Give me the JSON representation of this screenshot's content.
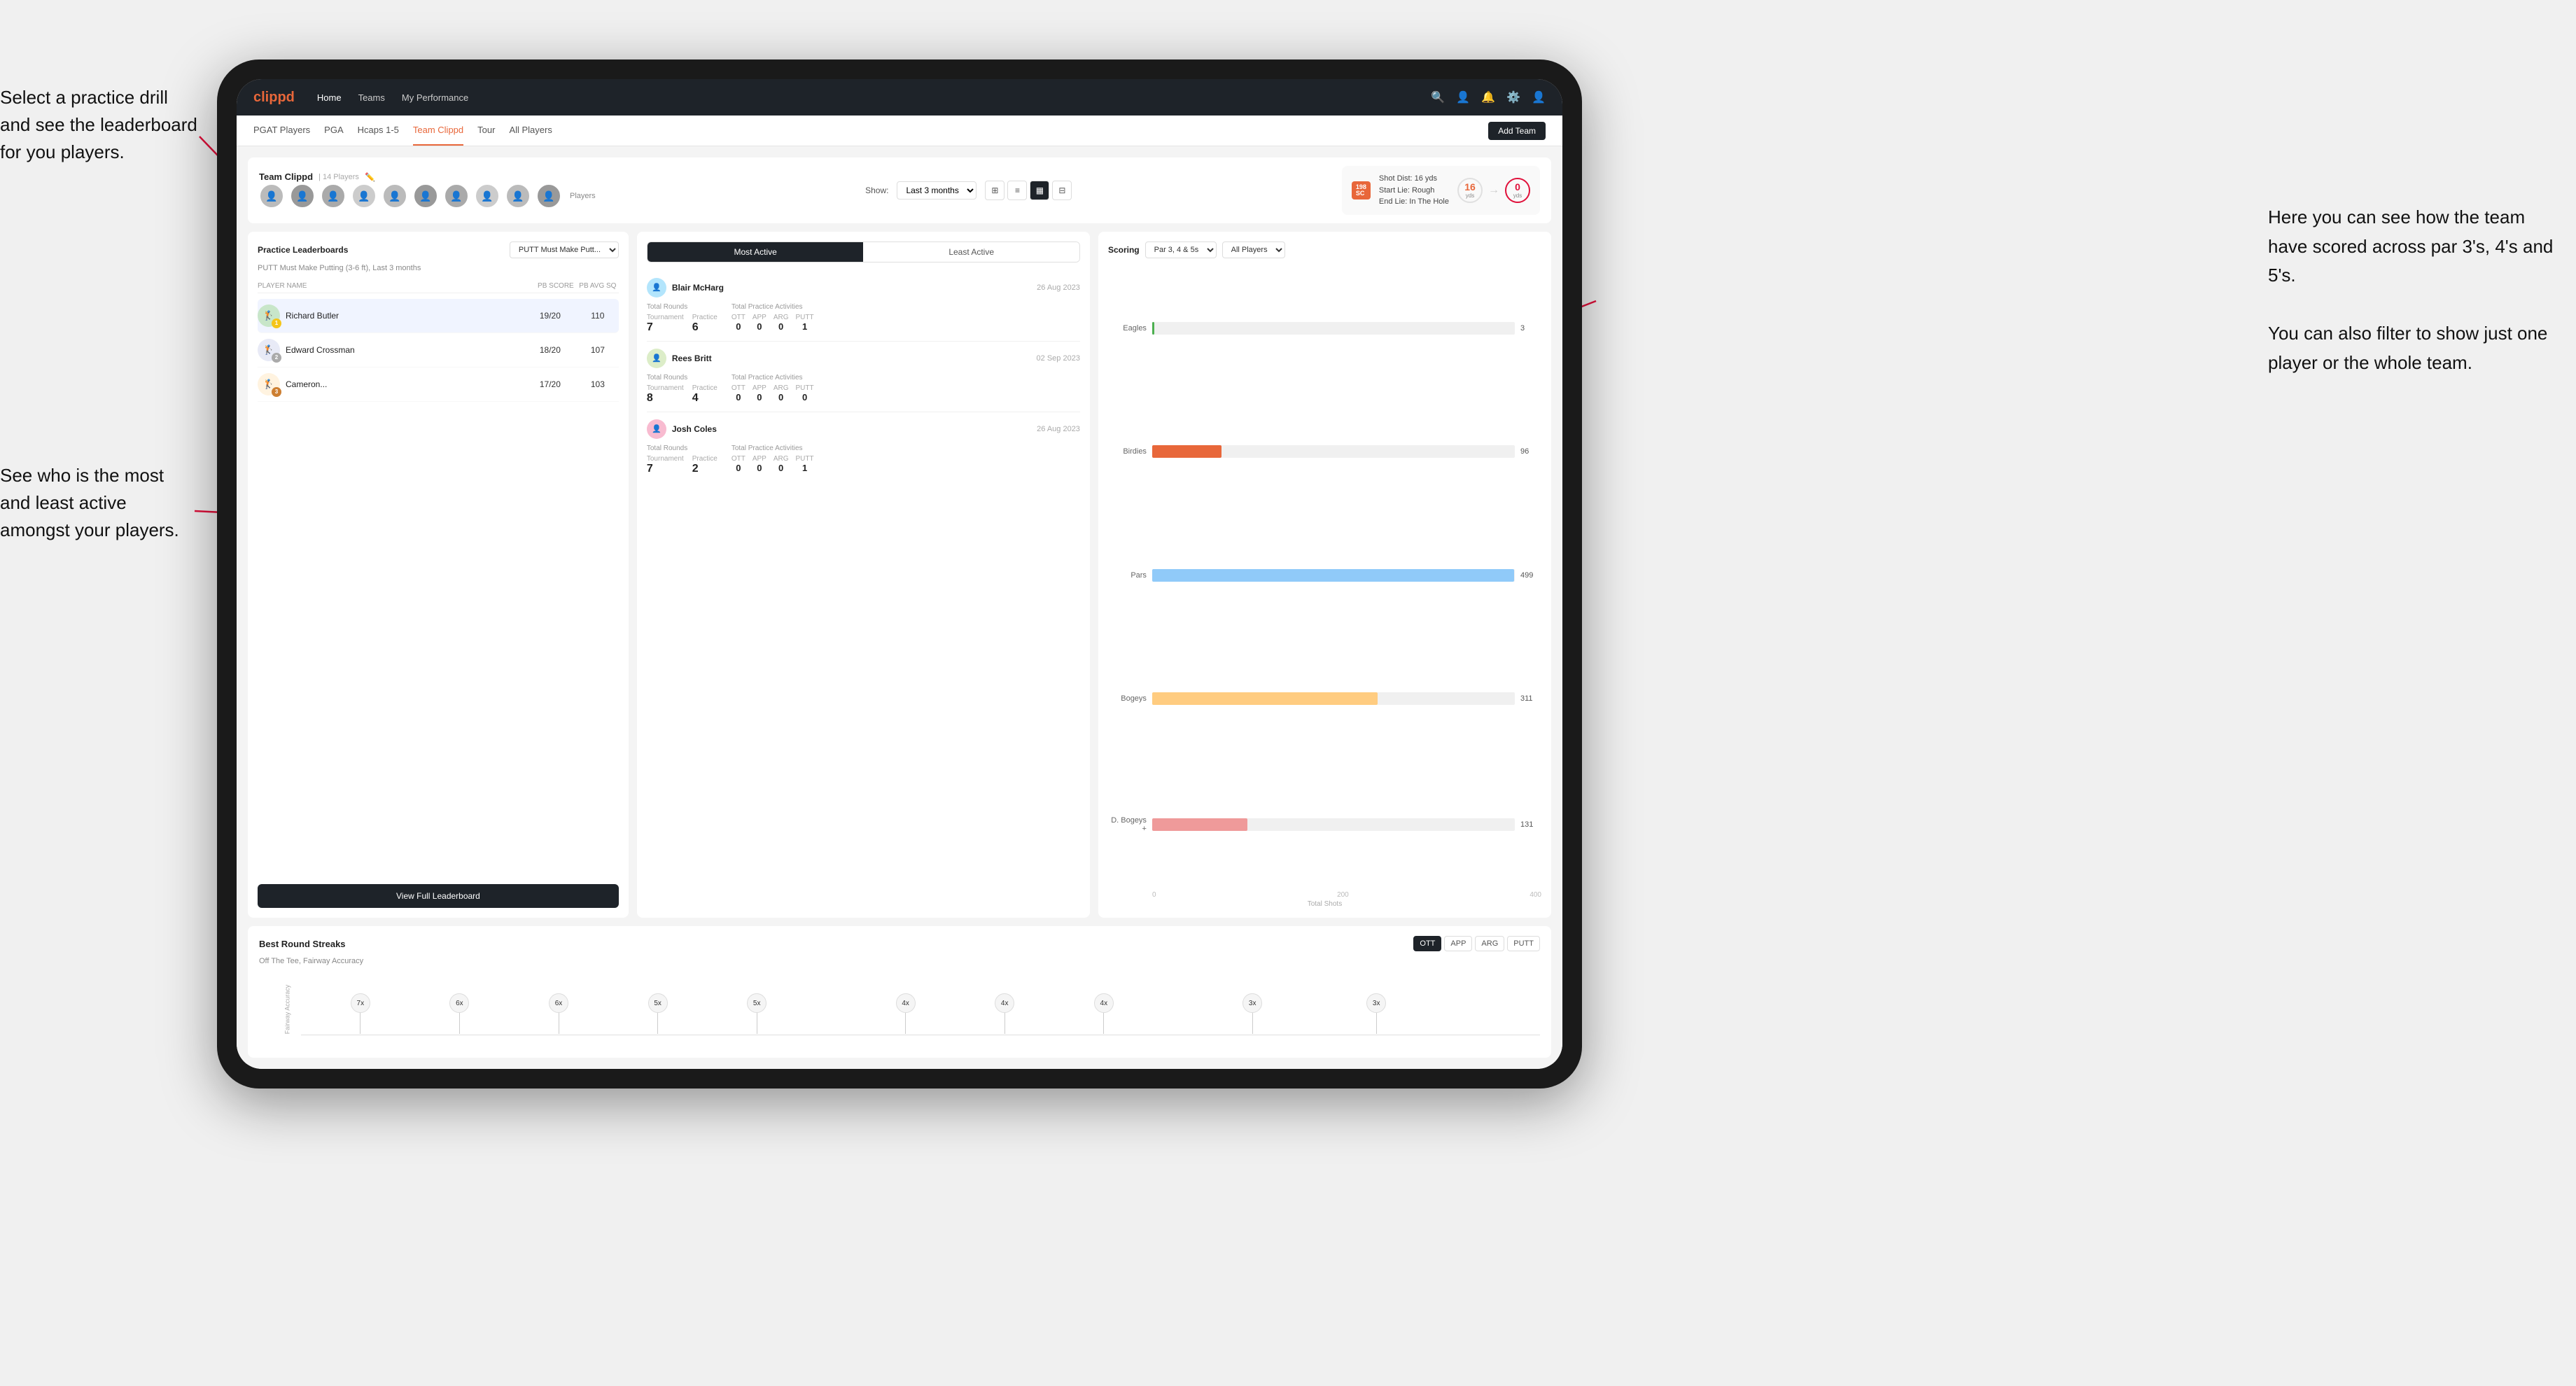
{
  "annotations": {
    "top_left": "Select a practice drill and see\nthe leaderboard for you players.",
    "bottom_left": "See who is the most and least\nactive amongst your players.",
    "top_right": "Here you can see how the\nteam have scored across\npar 3's, 4's and 5's.\n\nYou can also filter to show\njust one player or the whole\nteam."
  },
  "nav": {
    "logo": "clippd",
    "items": [
      "Home",
      "Teams",
      "My Performance"
    ],
    "icons": [
      "🔍",
      "👤",
      "🔔",
      "⚙️",
      "👤"
    ]
  },
  "subnav": {
    "items": [
      "PGAT Players",
      "PGA",
      "Hcaps 1-5",
      "Team Clippd",
      "Tour",
      "All Players"
    ],
    "active": "Team Clippd",
    "add_team": "Add Team"
  },
  "team_header": {
    "title": "Team Clippd",
    "player_count": "14 Players",
    "show_label": "Show:",
    "show_value": "Last 3 months",
    "avatars": [
      "👤",
      "👤",
      "👤",
      "👤",
      "👤",
      "👤",
      "👤",
      "👤",
      "👤",
      "👤"
    ],
    "players_label": "Players",
    "shot": {
      "badge": "198",
      "badge_sub": "SC",
      "dist_label": "Shot Dist: 16 yds",
      "start_lie": "Start Lie: Rough",
      "end_lie": "End Lie: In The Hole",
      "circle1_val": "16",
      "circle1_unit": "yds",
      "circle2_val": "0",
      "circle2_unit": "yds"
    }
  },
  "leaderboard": {
    "title": "Practice Leaderboards",
    "drill": "PUTT Must Make Putt...",
    "subtitle": "PUTT Must Make Putting (3-6 ft), Last 3 months",
    "col_name": "PLAYER NAME",
    "col_score": "PB SCORE",
    "col_avg": "PB AVG SQ",
    "players": [
      {
        "name": "Richard Butler",
        "score": "19/20",
        "avg": "110",
        "rank": 1,
        "badge": "gold",
        "badge_num": "1"
      },
      {
        "name": "Edward Crossman",
        "score": "18/20",
        "avg": "107",
        "rank": 2,
        "badge": "silver",
        "badge_num": "2"
      },
      {
        "name": "Cameron...",
        "score": "17/20",
        "avg": "103",
        "rank": 3,
        "badge": "bronze",
        "badge_num": "3"
      }
    ],
    "view_full": "View Full Leaderboard"
  },
  "activity": {
    "tab_active": "Most Active",
    "tab_inactive": "Least Active",
    "players": [
      {
        "name": "Blair McHarg",
        "date": "26 Aug 2023",
        "rounds_label": "Total Rounds",
        "tournament": "7",
        "practice": "6",
        "activities_label": "Total Practice Activities",
        "ott": "0",
        "app": "0",
        "arg": "0",
        "putt": "1"
      },
      {
        "name": "Rees Britt",
        "date": "02 Sep 2023",
        "rounds_label": "Total Rounds",
        "tournament": "8",
        "practice": "4",
        "activities_label": "Total Practice Activities",
        "ott": "0",
        "app": "0",
        "arg": "0",
        "putt": "0"
      },
      {
        "name": "Josh Coles",
        "date": "26 Aug 2023",
        "rounds_label": "Total Rounds",
        "tournament": "7",
        "practice": "2",
        "activities_label": "Total Practice Activities",
        "ott": "0",
        "app": "0",
        "arg": "0",
        "putt": "1"
      }
    ]
  },
  "scoring": {
    "title": "Scoring",
    "filter1": "Par 3, 4 & 5s",
    "filter2": "All Players",
    "bars": [
      {
        "label": "Eagles",
        "value": 3,
        "max": 500,
        "class": "bar-eagles"
      },
      {
        "label": "Birdies",
        "value": 96,
        "max": 500,
        "class": "bar-birdies"
      },
      {
        "label": "Pars",
        "value": 499,
        "max": 500,
        "class": "bar-pars"
      },
      {
        "label": "Bogeys",
        "value": 311,
        "max": 500,
        "class": "bar-bogeys"
      },
      {
        "label": "D. Bogeys +",
        "value": 131,
        "max": 500,
        "class": "bar-dbogeys"
      }
    ],
    "axis": [
      "0",
      "200",
      "400"
    ],
    "total_shots": "Total Shots"
  },
  "best_round_streaks": {
    "title": "Best Round Streaks",
    "subtitle": "Off The Tee, Fairway Accuracy",
    "tabs": [
      "OTT",
      "APP",
      "ARG",
      "PUTT"
    ],
    "active_tab": "OTT",
    "pins": [
      {
        "val": "7x",
        "x": 8
      },
      {
        "val": "6x",
        "x": 15
      },
      {
        "val": "6x",
        "x": 22
      },
      {
        "val": "5x",
        "x": 30
      },
      {
        "val": "5x",
        "x": 37
      },
      {
        "val": "4x",
        "x": 50
      },
      {
        "val": "4x",
        "x": 57
      },
      {
        "val": "4x",
        "x": 64
      },
      {
        "val": "3x",
        "x": 75
      },
      {
        "val": "3x",
        "x": 82
      }
    ]
  }
}
